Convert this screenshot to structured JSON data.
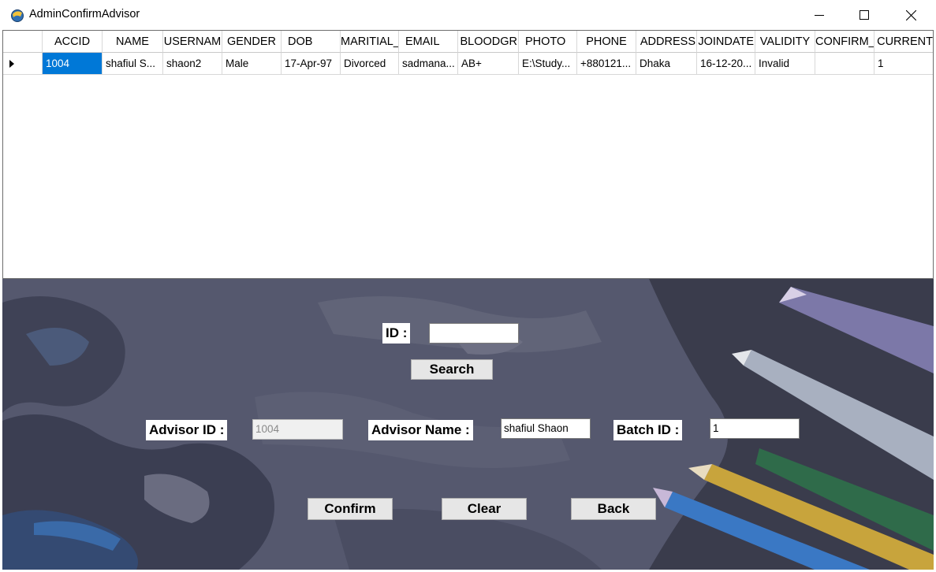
{
  "window": {
    "title": "AdminConfirmAdvisor",
    "icon": "app-icon"
  },
  "grid": {
    "columns": [
      "ACCID",
      "NAME",
      "USERNAM",
      "GENDER",
      "DOB",
      "MARITIAL_",
      "EMAIL",
      "BLOODGR",
      "PHOTO",
      "PHONE",
      "ADDRESS",
      "JOINDATE",
      "VALIDITY",
      "CONFIRM_",
      "CURRENT"
    ],
    "rows": [
      [
        "1004",
        "shafiul S...",
        "shaon2",
        "Male",
        "17-Apr-97",
        "Divorced",
        "sadmana...",
        "AB+",
        "E:\\Study...",
        "+880121...",
        "Dhaka",
        "16-12-20...",
        "Invalid",
        "",
        "1"
      ]
    ]
  },
  "search": {
    "id_label": "ID :",
    "id_value": "",
    "search_label": "Search"
  },
  "form": {
    "advisor_id_label": "Advisor ID :",
    "advisor_id_value": "1004",
    "advisor_name_label": "Advisor Name :",
    "advisor_name_value": "shafiul Shaon",
    "batch_id_label": "Batch ID :",
    "batch_id_value": "1"
  },
  "actions": {
    "confirm": "Confirm",
    "clear": "Clear",
    "back": "Back"
  },
  "colors": {
    "selection": "#0078d7",
    "panel_bg": "#52546a"
  }
}
